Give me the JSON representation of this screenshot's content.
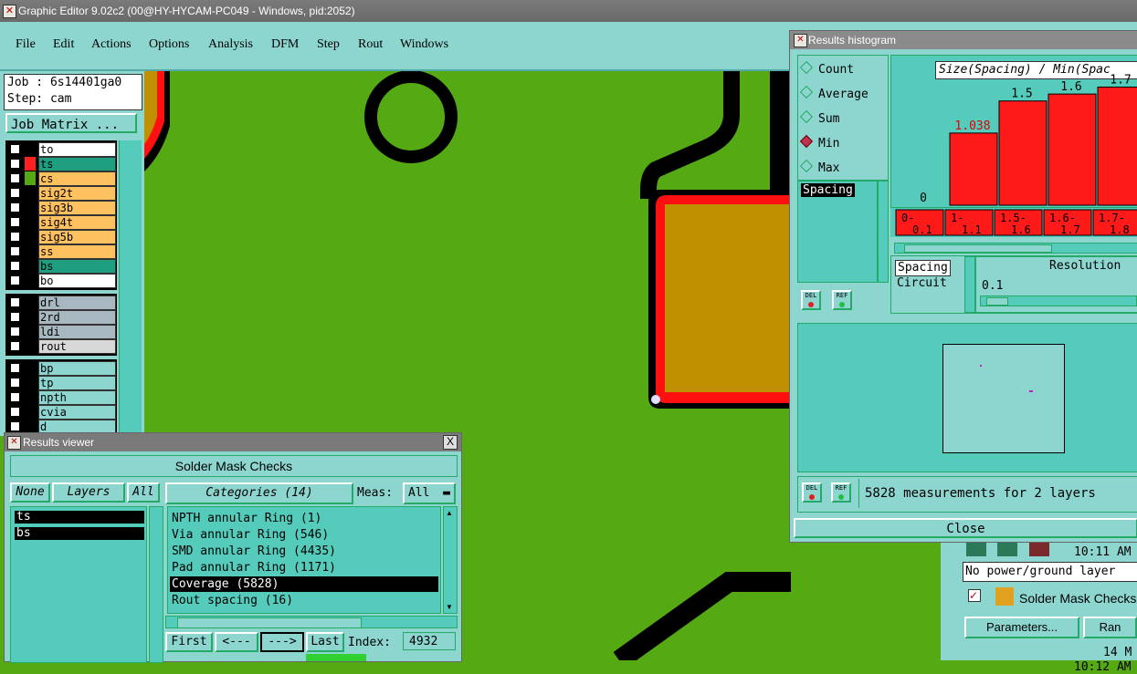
{
  "window": {
    "title": "Graphic Editor 9.02c2 (00@HY-HYCAM-PC049 - Windows, pid:2052)"
  },
  "menu": [
    "File",
    "Edit",
    "Actions",
    "Options",
    "Analysis",
    "DFM",
    "Step",
    "Rout",
    "Windows"
  ],
  "job": {
    "job": "Job : 6s14401ga0",
    "step": "Step: cam",
    "matrix_button": "Job Matrix ..."
  },
  "layers_board": [
    {
      "name": "to",
      "color": "#ffffff"
    },
    {
      "name": "ts",
      "color": "#1f9f7f",
      "swatch": "#ff2020"
    },
    {
      "name": "cs",
      "color": "#ffc060",
      "swatch": "#55aa14"
    },
    {
      "name": "sig2t",
      "color": "#ffc060"
    },
    {
      "name": "sig3b",
      "color": "#ffc060"
    },
    {
      "name": "sig4t",
      "color": "#ffc060"
    },
    {
      "name": "sig5b",
      "color": "#ffc060"
    },
    {
      "name": "ss",
      "color": "#ffc060"
    },
    {
      "name": "bs",
      "color": "#1f9f7f"
    },
    {
      "name": "bo",
      "color": "#ffffff"
    }
  ],
  "layers_drill": [
    {
      "name": "drl",
      "color": "#a8b8c0"
    },
    {
      "name": "2rd",
      "color": "#a8b8c0"
    },
    {
      "name": "ldi",
      "color": "#a8b8c0"
    },
    {
      "name": "rout",
      "color": "#d8d8d8"
    }
  ],
  "layers_misc": [
    {
      "name": "bp",
      "color": "#8dd6d0"
    },
    {
      "name": "tp",
      "color": "#8dd6d0"
    },
    {
      "name": "npth",
      "color": "#8dd6d0"
    },
    {
      "name": "cvia",
      "color": "#8dd6d0"
    },
    {
      "name": "d",
      "color": "#8dd6d0"
    }
  ],
  "results_viewer": {
    "title": "Results viewer",
    "close": "X",
    "header": "Solder Mask Checks",
    "none_btn": "None",
    "layers_label": "Layers",
    "all_btn": "All",
    "categories_label": "Categories (14)",
    "meas_label": "Meas:",
    "meas_value": "All",
    "layers": [
      "ts",
      "bs"
    ],
    "categories": [
      "NPTH annular Ring (1)",
      "Via annular Ring (546)",
      "SMD annular Ring (4435)",
      "Pad annular Ring (1171)",
      "Coverage (5828)",
      "Rout spacing (16)"
    ],
    "selected_category": 4,
    "nav": {
      "first": "First",
      "prev": "<---",
      "next": "--->",
      "last": "Last",
      "index_label": "Index:",
      "index_value": "4932"
    }
  },
  "histogram": {
    "title": "Results histogram",
    "options": [
      "Count",
      "Average",
      "Sum",
      "Min",
      "Max"
    ],
    "selected_option": "Min",
    "list_item": "Spacing",
    "del": "DEL",
    "ref": "REF",
    "measure_items": [
      "Spacing",
      "Circuit"
    ],
    "resolution_label": "Resolution",
    "resolution_value": "0.1",
    "status": "5828 measurements for 2 layers",
    "close": "Close"
  },
  "chart_data": {
    "type": "bar",
    "title": "Size(Spacing) / Min(Spac",
    "categories": [
      "0-0.1",
      "1-1.1",
      "1.5-1.6",
      "1.6-1.7",
      "1.7-1.8"
    ],
    "category_lines": [
      [
        "0-",
        "0.1"
      ],
      [
        "1-",
        "1.1"
      ],
      [
        "1.5-",
        "1.6"
      ],
      [
        "1.6-",
        "1.7"
      ],
      [
        "1.7-",
        "1.8"
      ]
    ],
    "values": [
      0,
      1.038,
      1.5,
      1.6,
      1.7
    ],
    "value_labels": [
      "0",
      "1.038",
      "1.5",
      "1.6",
      "1.7"
    ],
    "bar_color": "#ff1a1a",
    "highlight_label_color": "#e00000",
    "ylim": [
      0,
      2.1
    ]
  },
  "status_strip": {
    "time1": "10:11 AM",
    "message": "No power/ground layer",
    "checks_label": "Solder Mask Checks",
    "parameters_btn": "Parameters...",
    "ran_btn": "Ran",
    "date_line": "14 M",
    "time2": "10:12 AM"
  }
}
